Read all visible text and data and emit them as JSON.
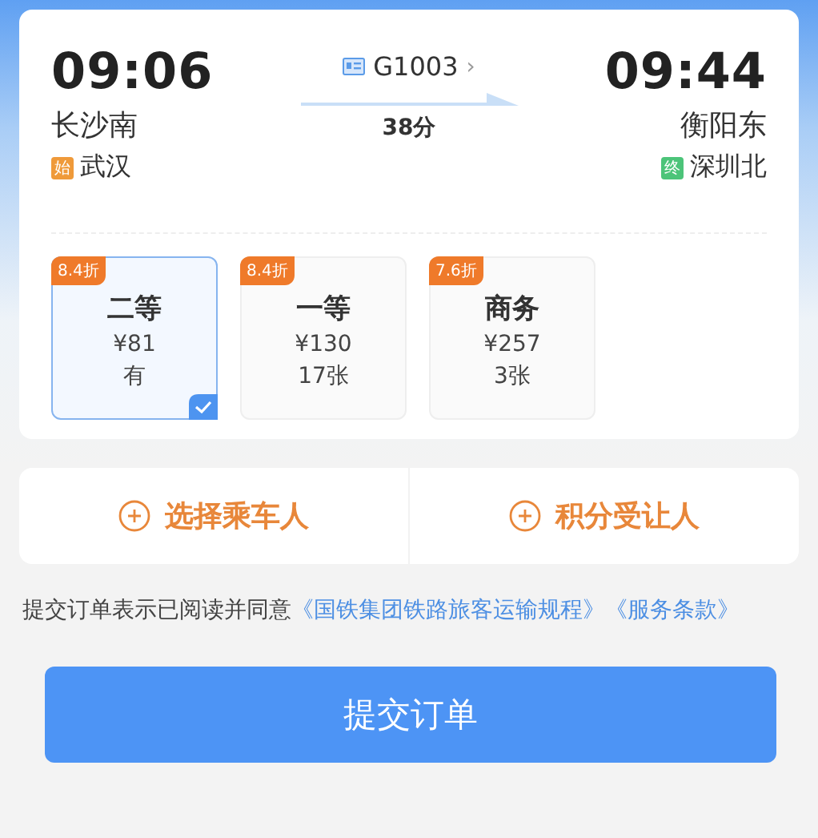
{
  "trip": {
    "depart_time": "09:06",
    "depart_station": "长沙南",
    "origin_badge": "始",
    "origin": "武汉",
    "train_no": "G1003",
    "chevron": "›",
    "duration": "38分",
    "arrive_time": "09:44",
    "arrive_station": "衡阳东",
    "terminal_badge": "终",
    "terminal": "深圳北"
  },
  "seats": [
    {
      "discount": "8.4折",
      "class": "二等",
      "price": "¥81",
      "availability": "有",
      "selected": true
    },
    {
      "discount": "8.4折",
      "class": "一等",
      "price": "¥130",
      "availability": "17张",
      "selected": false
    },
    {
      "discount": "7.6折",
      "class": "商务",
      "price": "¥257",
      "availability": "3张",
      "selected": false
    }
  ],
  "actions": [
    {
      "label": "选择乘车人"
    },
    {
      "label": "积分受让人"
    }
  ],
  "terms": {
    "text": "提交订单表示已阅读并同意",
    "links": [
      "《国铁集团铁路旅客运输规程》",
      "《服务条款》"
    ]
  },
  "submit": "提交订单"
}
